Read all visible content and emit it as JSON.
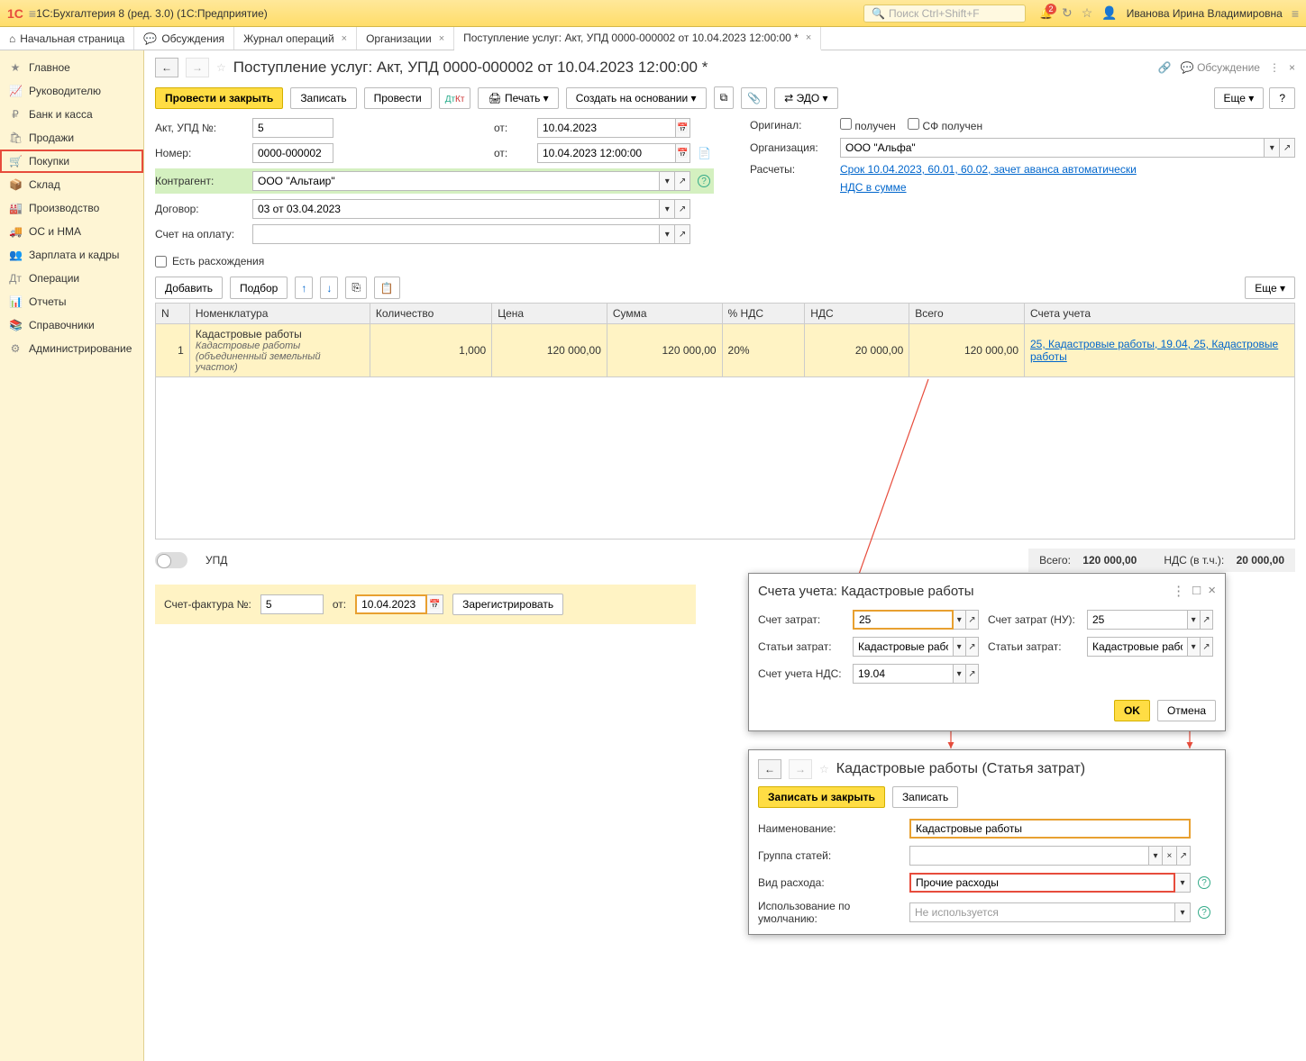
{
  "header": {
    "app_title": "1С:Бухгалтерия 8 (ред. 3.0)  (1С:Предприятие)",
    "search_placeholder": "Поиск Ctrl+Shift+F",
    "bell_count": "2",
    "user": "Иванова Ирина Владимировна"
  },
  "tabs": {
    "home": "Начальная страница",
    "discuss": "Обсуждения",
    "journal": "Журнал операций",
    "orgs": "Организации",
    "current": "Поступление услуг: Акт, УПД 0000-000002 от 10.04.2023 12:00:00 *"
  },
  "sidebar": {
    "items": [
      "Главное",
      "Руководителю",
      "Банк и касса",
      "Продажи",
      "Покупки",
      "Склад",
      "Производство",
      "ОС и НМА",
      "Зарплата и кадры",
      "Операции",
      "Отчеты",
      "Справочники",
      "Администрирование"
    ]
  },
  "doc": {
    "title": "Поступление услуг: Акт, УПД 0000-000002 от 10.04.2023 12:00:00 *",
    "discuss_link": "Обсуждение"
  },
  "toolbar": {
    "post_close": "Провести и закрыть",
    "save": "Записать",
    "post": "Провести",
    "print": "Печать",
    "create_based": "Создать на основании",
    "edo": "ЭДО",
    "more": "Еще"
  },
  "form": {
    "akt_label": "Акт, УПД №:",
    "akt_value": "5",
    "ot": "от:",
    "akt_date": "10.04.2023",
    "original_label": "Оригинал:",
    "received": "получен",
    "sf_received": "СФ получен",
    "number_label": "Номер:",
    "number_value": "0000-000002",
    "number_date": "10.04.2023 12:00:00",
    "org_label": "Организация:",
    "org_value": "ООО \"Альфа\"",
    "contragent_label": "Контрагент:",
    "contragent_value": "ООО \"Альтаир\"",
    "raschety_label": "Расчеты:",
    "raschety_link": "Срок 10.04.2023, 60.01, 60.02, зачет аванса автоматически",
    "dogovor_label": "Договор:",
    "dogovor_value": "03 от 03.04.2023",
    "nds_link": "НДС в сумме",
    "schet_oplatu_label": "Счет на оплату:",
    "discrepancy": "Есть расхождения"
  },
  "table_toolbar": {
    "add": "Добавить",
    "select": "Подбор",
    "more": "Еще"
  },
  "table": {
    "headers": [
      "N",
      "Номенклатура",
      "Количество",
      "Цена",
      "Сумма",
      "% НДС",
      "НДС",
      "Всего",
      "Счета учета"
    ],
    "row": {
      "n": "1",
      "nomen": "Кадастровые работы",
      "nomen_sub": "Кадастровые работы (объединенный земельный участок)",
      "qty": "1,000",
      "price": "120 000,00",
      "sum": "120 000,00",
      "nds_pct": "20%",
      "nds": "20 000,00",
      "total": "120 000,00",
      "accounts": "25, Кадастровые работы, 19.04, 25, Кадастровые работы"
    }
  },
  "totals": {
    "upd": "УПД",
    "vsego_label": "Всего:",
    "vsego": "120 000,00",
    "nds_label": "НДС (в т.ч.):",
    "nds": "20 000,00"
  },
  "sf": {
    "label": "Счет-фактура №:",
    "num": "5",
    "ot": "от:",
    "date": "10.04.2023",
    "register": "Зарегистрировать"
  },
  "dialog1": {
    "title": "Счета учета: Кадастровые работы",
    "schet_zatrat": "Счет затрат:",
    "schet_zatrat_val": "25",
    "schet_zatrat_nu": "Счет затрат (НУ):",
    "schet_zatrat_nu_val": "25",
    "stati_zatrat": "Статьи затрат:",
    "stati_zatrat_val": "Кадастровые работы",
    "stati_zatrat2": "Статьи затрат:",
    "stati_zatrat2_val": "Кадастровые работы",
    "schet_nds": "Счет учета НДС:",
    "schet_nds_val": "19.04",
    "ok": "OK",
    "cancel": "Отмена"
  },
  "dialog2": {
    "title": "Кадастровые работы (Статья затрат)",
    "save_close": "Записать и закрыть",
    "save": "Записать",
    "name_label": "Наименование:",
    "name_value": "Кадастровые работы",
    "group_label": "Группа статей:",
    "vid_label": "Вид расхода:",
    "vid_value": "Прочие расходы",
    "usage_label": "Использование по умолчанию:",
    "usage_value": "Не используется"
  }
}
